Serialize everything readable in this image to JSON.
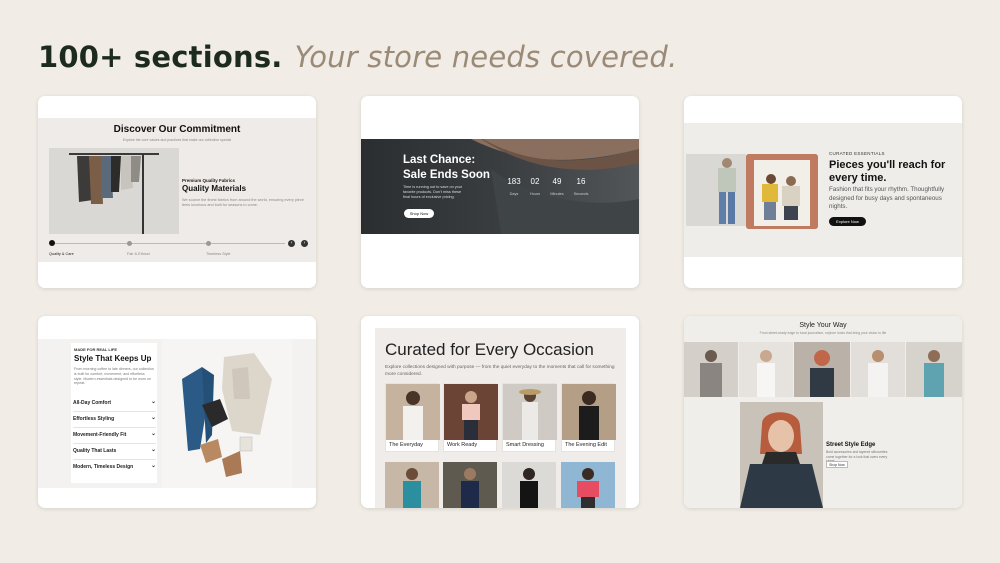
{
  "headline": {
    "bold": "100+ sections.",
    "italic": "Your store needs covered."
  },
  "card1": {
    "title": "Discover Our Commitment",
    "subtitle": "Explore the core values and practices that make our collection special",
    "eyebrow": "Premium Quality Fabrics",
    "heading": "Quality Materials",
    "body": "We source the finest fabrics from around the world, ensuring every piece feels luxurious and built for seasons to come.",
    "steps": [
      "Quality & Care",
      "Fair & Ethical",
      "Timeless Style"
    ],
    "prev_icon": "chevron-left-icon",
    "next_icon": "chevron-right-icon"
  },
  "card2": {
    "title_line1": "Last Chance:",
    "title_line2": "Sale Ends Soon",
    "body": "Time is running out to save on your favorite products. Don't miss these final hours of exclusive pricing.",
    "button": "Shop Now",
    "countdown": [
      {
        "value": "183",
        "label": "Days"
      },
      {
        "value": "02",
        "label": "Hours"
      },
      {
        "value": "49",
        "label": "Minutes"
      },
      {
        "value": "16",
        "label": "Seconds"
      }
    ]
  },
  "card3": {
    "eyebrow": "CURATED ESSENTIALS",
    "title_line1": "Pieces you'll reach for",
    "title_line2": "every time.",
    "body": "Fashion that fits your rhythm. Thoughtfully designed for busy days and spontaneous nights.",
    "button": "Explore Now"
  },
  "card4": {
    "eyebrow": "MADE FOR REAL LIFE",
    "title": "Style That Keeps Up",
    "body": "From morning coffee to late dinners, our collection is built for comfort, movement, and effortless style. Modern essentials designed to be worn on repeat.",
    "items": [
      "All-Day Comfort",
      "Effortless Styling",
      "Movement-Friendly Fit",
      "Quality That Lasts",
      "Modern, Timeless Design"
    ]
  },
  "card5": {
    "title": "Curated for Every Occasion",
    "body": "Explore collections designed with purpose — from the quiet everyday to the moments that call for something more considered.",
    "tiles": [
      "The Everyday",
      "Work Ready",
      "Smart Dressing",
      "The Evening Edit"
    ]
  },
  "card6": {
    "title": "Style Your Way",
    "subtitle": "From street-ready edge to local journalism, explore looks that bring your vision to life",
    "feature_title": "Street Style Edge",
    "feature_body": "Bold accessories and layered silhouettes come together for a look that owns every street.",
    "button": "Shop Now"
  }
}
